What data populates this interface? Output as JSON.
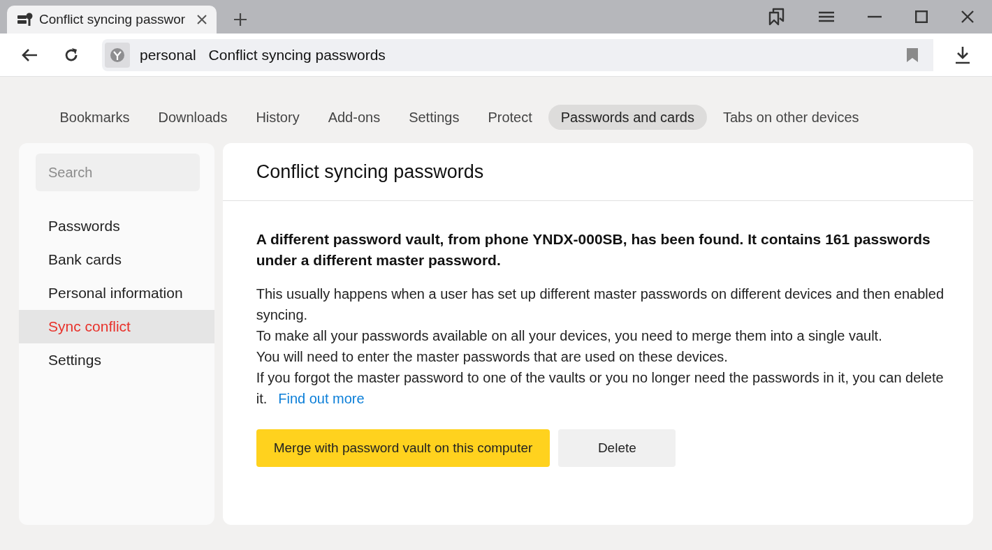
{
  "browser_tab": {
    "title": "Conflict syncing passwor"
  },
  "address_bar": {
    "site": "personal",
    "page_title": "Conflict syncing passwords"
  },
  "nav_tabs": [
    {
      "label": "Bookmarks",
      "selected": false
    },
    {
      "label": "Downloads",
      "selected": false
    },
    {
      "label": "History",
      "selected": false
    },
    {
      "label": "Add-ons",
      "selected": false
    },
    {
      "label": "Settings",
      "selected": false
    },
    {
      "label": "Protect",
      "selected": false
    },
    {
      "label": "Passwords and cards",
      "selected": true
    },
    {
      "label": "Tabs on other devices",
      "selected": false
    }
  ],
  "sidebar": {
    "search": {
      "placeholder": "Search"
    },
    "items": [
      {
        "label": "Passwords",
        "selected": false
      },
      {
        "label": "Bank cards",
        "selected": false
      },
      {
        "label": "Personal information",
        "selected": false
      },
      {
        "label": "Sync conflict",
        "selected": true
      },
      {
        "label": "Settings",
        "selected": false
      }
    ]
  },
  "main": {
    "title": "Conflict syncing passwords",
    "lead": "A different password vault, from phone YNDX-000SB, has been found. It contains 161 passwords under a different master password.",
    "paragraphs": [
      "This usually happens when a user has set up different master passwords on different devices and then enabled syncing.",
      "To make all your passwords available on all your devices, you need to merge them into a single vault.",
      "You will need to enter the master passwords that are used on these devices.",
      "If you forgot the master password to one of the vaults or you no longer need the passwords in it, you can delete it."
    ],
    "link": "Find out more",
    "buttons": [
      {
        "label": "Merge with password vault on this computer",
        "kind": "primary"
      },
      {
        "label": "Delete",
        "kind": "secondary"
      }
    ]
  }
}
